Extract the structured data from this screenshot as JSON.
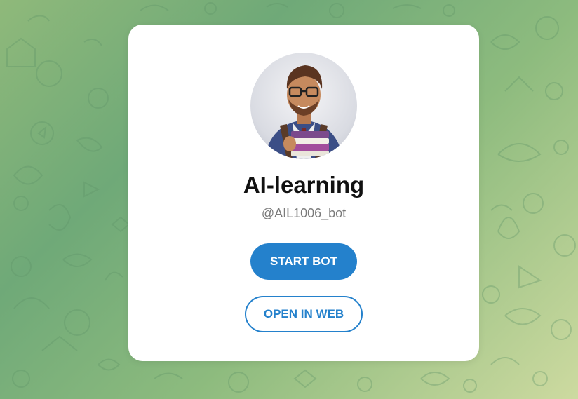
{
  "bot": {
    "name": "AI-learning",
    "username": "@AIL1006_bot",
    "start_label": "START BOT",
    "open_web_label": "OPEN IN WEB"
  },
  "colors": {
    "accent": "#2481cc",
    "card": "#ffffff",
    "title": "#111111",
    "username": "#7a7a7a",
    "background_green": "#6fa978"
  },
  "icons": {
    "avatar": "bot-avatar-image",
    "background": "doodle-pattern"
  }
}
